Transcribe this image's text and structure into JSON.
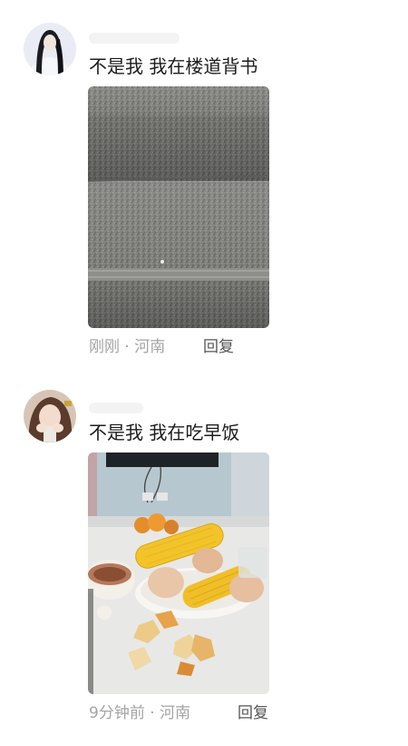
{
  "comments": [
    {
      "text": "不是我 我在楼道背书",
      "time": "刚刚",
      "separator": "·",
      "location": "河南",
      "reply_label": "回复",
      "avatar_icon": "user-avatar-icon",
      "photo": "stairs-photo"
    },
    {
      "text": "不是我 我在吃早饭",
      "time": "9分钟前",
      "separator": "·",
      "location": "河南",
      "reply_label": "回复",
      "avatar_icon": "user-avatar-icon",
      "photo": "breakfast-photo"
    }
  ],
  "colors": {
    "text": "#1c1c1c",
    "meta": "#a4a4a4",
    "reply": "#555555",
    "background": "#ffffff"
  }
}
